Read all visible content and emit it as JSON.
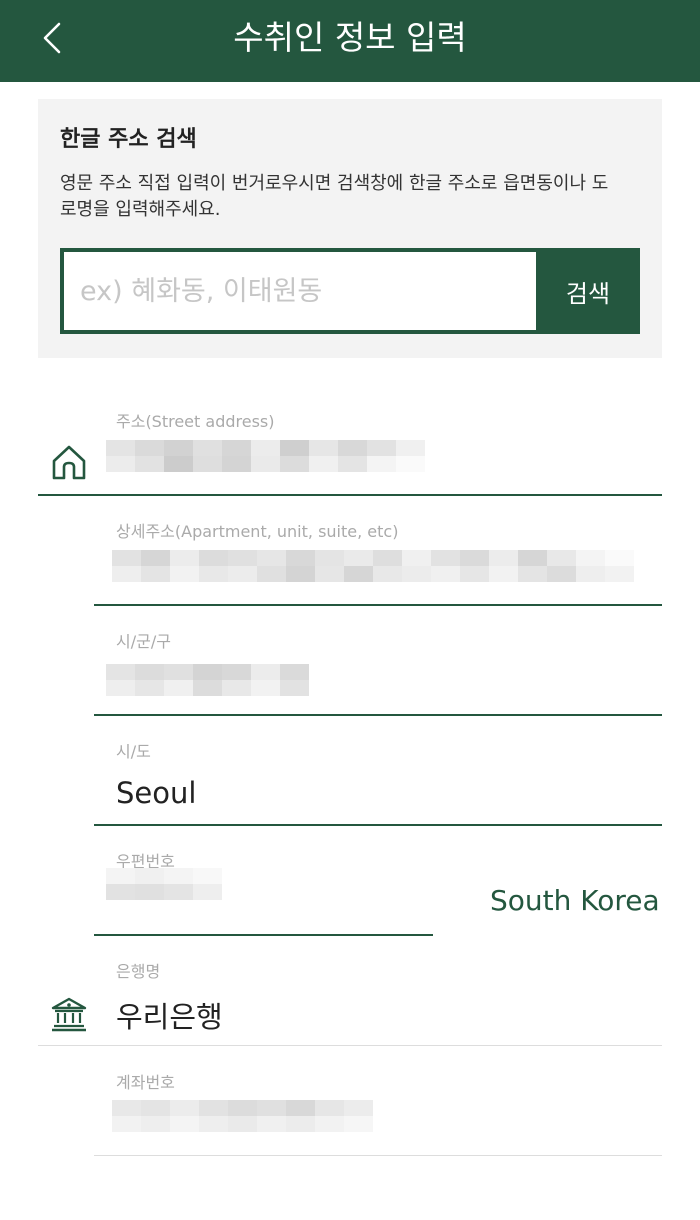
{
  "header": {
    "title": "수취인 정보 입력",
    "back_icon": "chevron-left-icon",
    "background": "#24573f"
  },
  "search": {
    "heading": "한글 주소 검색",
    "description": "영문 주소 직접 입력이 번거로우시면 검색창에 한글 주소로 읍면동이나 도로명을 입력해주세요.",
    "placeholder": "ex) 혜화동, 이태원동",
    "value": "",
    "button_label": "검색"
  },
  "fields": {
    "street": {
      "label": "주소(Street address)",
      "icon": "home-icon"
    },
    "detail": {
      "label": "상세주소(Apartment, unit, suite, etc)"
    },
    "district": {
      "label": "시/군/구"
    },
    "province": {
      "label": "시/도",
      "value": "Seoul"
    },
    "postal": {
      "label": "우편번호"
    },
    "country": {
      "value": "South Korea"
    },
    "bank": {
      "label": "은행명",
      "value": "우리은행",
      "icon": "bank-icon"
    },
    "account": {
      "label": "계좌번호"
    }
  },
  "colors": {
    "accent": "#24573f",
    "label": "#aaaaaa",
    "panel": "#f3f3f3"
  }
}
